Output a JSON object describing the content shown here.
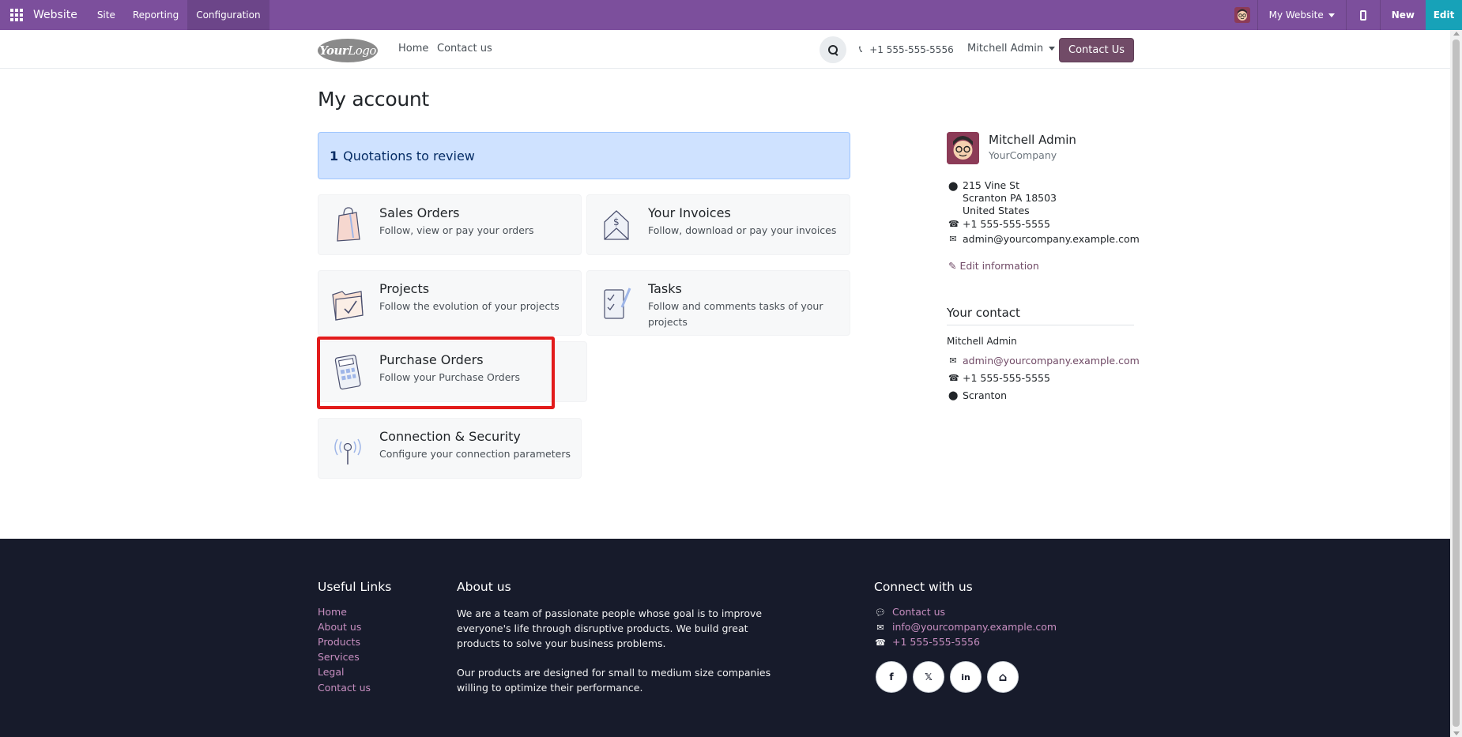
{
  "admin_bar": {
    "brand": "Website",
    "menus": [
      {
        "label": "Site"
      },
      {
        "label": "Reporting"
      },
      {
        "label": "Configuration"
      }
    ],
    "website_selector": "My Website",
    "new_label": "New",
    "edit_label": "Edit",
    "accent": "#7c4f9c"
  },
  "header": {
    "logo_text_bold": "Your",
    "logo_text": "Logo",
    "nav": [
      {
        "label": "Home"
      },
      {
        "label": "Contact us"
      }
    ],
    "phone": "+1 555-555-5556",
    "user": "Mitchell Admin",
    "cta": "Contact Us",
    "cta_color": "#714b67"
  },
  "main": {
    "title": "My account",
    "alert": {
      "count": "1",
      "text": "Quotations to review"
    },
    "cards": [
      {
        "title": "Sales Orders",
        "desc": "Follow, view or pay your orders",
        "icon": "shopping-bag-icon"
      },
      {
        "title": "Your Invoices",
        "desc": "Follow, download or pay your invoices",
        "icon": "invoice-envelope-icon"
      },
      {
        "title": "Projects",
        "desc": "Follow the evolution of your projects",
        "icon": "folder-check-icon"
      },
      {
        "title": "Tasks",
        "desc": "Follow and comments tasks of your projects",
        "icon": "task-checklist-icon"
      },
      {
        "title": "Purchase Orders",
        "desc": "Follow your Purchase Orders",
        "icon": "calculator-icon"
      },
      {
        "title": "Connection & Security",
        "desc": "Configure your connection parameters",
        "icon": "antenna-icon"
      }
    ]
  },
  "profile": {
    "name": "Mitchell Admin",
    "company": "YourCompany",
    "address_lines": [
      "215 Vine St",
      "Scranton PA 18503",
      "United States"
    ],
    "phone": "+1 555-555-5555",
    "email": "admin@yourcompany.example.com",
    "edit_label": "Edit information"
  },
  "your_contact": {
    "heading": "Your contact",
    "name": "Mitchell Admin",
    "email": "admin@yourcompany.example.com",
    "phone": "+1 555-555-5555",
    "city": "Scranton"
  },
  "footer": {
    "useful_links_heading": "Useful Links",
    "useful_links": [
      {
        "label": "Home"
      },
      {
        "label": "About us"
      },
      {
        "label": "Products"
      },
      {
        "label": "Services"
      },
      {
        "label": "Legal"
      },
      {
        "label": "Contact us"
      }
    ],
    "about_heading": "About us",
    "about_p1": "We are a team of passionate people whose goal is to improve everyone's life through disruptive products. We build great products to solve your business problems.",
    "about_p2": "Our products are designed for small to medium size companies willing to optimize their performance.",
    "connect_heading": "Connect with us",
    "connect": [
      {
        "label": "Contact us",
        "icon": "comment-icon"
      },
      {
        "label": "info@yourcompany.example.com",
        "icon": "envelope-icon"
      },
      {
        "label": "+1 555-555-5556",
        "icon": "phone-icon"
      }
    ],
    "social": [
      {
        "icon": "facebook-icon",
        "glyph": "f"
      },
      {
        "icon": "x-twitter-icon",
        "glyph": "𝕏"
      },
      {
        "icon": "linkedin-icon",
        "glyph": "in"
      },
      {
        "icon": "home-icon",
        "glyph": "⌂"
      }
    ],
    "bg": "#171b2b",
    "link_color": "#c78ec0"
  }
}
